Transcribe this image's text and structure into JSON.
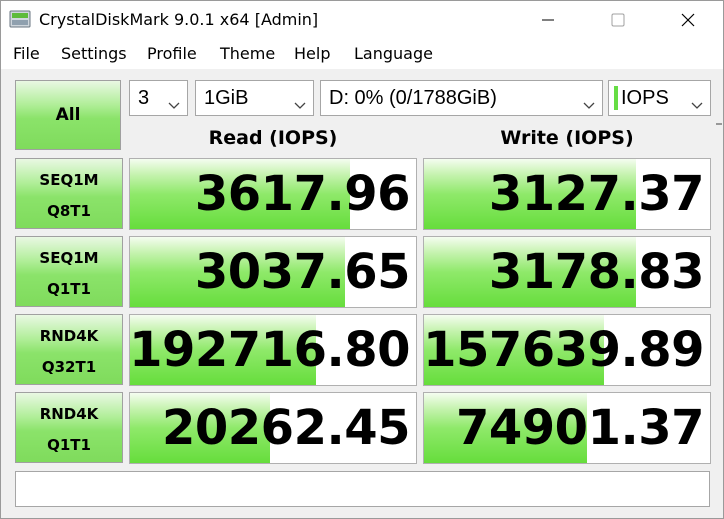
{
  "window": {
    "title": "CrystalDiskMark 9.0.1 x64 [Admin]"
  },
  "menu": {
    "items": [
      "File",
      "Settings",
      "Profile",
      "Theme",
      "Help",
      "Language"
    ]
  },
  "toolbar": {
    "all_label": "All",
    "count": "3",
    "size": "1GiB",
    "drive": "D: 0% (0/1788GiB)",
    "unit": "IOPS"
  },
  "headers": {
    "read": "Read (IOPS)",
    "write": "Write (IOPS)"
  },
  "tests": [
    {
      "line1": "SEQ1M",
      "line2": "Q8T1",
      "read": "3617.96",
      "write": "3127.37",
      "read_fill": 0.77,
      "write_fill": 0.74
    },
    {
      "line1": "SEQ1M",
      "line2": "Q1T1",
      "read": "3037.65",
      "write": "3178.83",
      "read_fill": 0.75,
      "write_fill": 0.74
    },
    {
      "line1": "RND4K",
      "line2": "Q32T1",
      "read": "192716.80",
      "write": "157639.89",
      "read_fill": 0.65,
      "write_fill": 0.63
    },
    {
      "line1": "RND4K",
      "line2": "Q1T1",
      "read": "20262.45",
      "write": "74901.37",
      "read_fill": 0.49,
      "write_fill": 0.57
    }
  ],
  "colors": {
    "accent_green": "#66dd3c",
    "panel_bg": "#f0f0f0"
  },
  "icons": {
    "app": "crystaldiskmark-drive-icon",
    "minimize": "minimize-icon",
    "maximize": "maximize-icon",
    "close": "close-icon",
    "dropdown": "chevron-down-icon"
  }
}
